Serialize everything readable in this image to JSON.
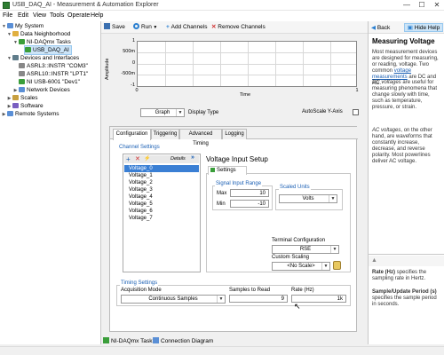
{
  "window": {
    "title": "USB_DAQ_AI - Measurement & Automation Explorer",
    "minimize": "—",
    "maximize": "☐",
    "close": "✕"
  },
  "menu": [
    "File",
    "Edit",
    "View",
    "Tools",
    "Operate",
    "Help"
  ],
  "tree": {
    "items": [
      {
        "label": "My System"
      },
      {
        "label": "Data Neighborhood"
      },
      {
        "label": "NI-DAQmx Tasks"
      },
      {
        "label": "USB_DAQ_AI"
      },
      {
        "label": "Devices and Interfaces"
      },
      {
        "label": "ASRL3::INSTR \"COM3\""
      },
      {
        "label": "ASRL10::INSTR \"LPT1\""
      },
      {
        "label": "NI USB-6001 \"Dev1\""
      },
      {
        "label": "Network Devices"
      },
      {
        "label": "Scales"
      },
      {
        "label": "Software"
      },
      {
        "label": "Remote Systems"
      }
    ]
  },
  "toolbar": {
    "save": "Save",
    "run": "Run",
    "add_channels": "Add Channels",
    "remove_channels": "Remove Channels",
    "hide_help": "Hide Help"
  },
  "graph": {
    "ylabel": "Amplitude",
    "xlabel": "Time",
    "yticks": [
      "1",
      "500m",
      "0",
      "-500m",
      "-1"
    ],
    "xticks": [
      "0",
      "1"
    ],
    "display_type_value": "Graph",
    "display_type_label": "Display Type",
    "autoscale_label": "AutoScale Y-Axis"
  },
  "config": {
    "tabs": [
      "Configuration",
      "Triggering",
      "Advanced Timing",
      "Logging"
    ],
    "channel_settings_label": "Channel Settings",
    "details_label": "Details",
    "channels": [
      "Voltage_0",
      "Voltage_1",
      "Voltage_2",
      "Voltage_3",
      "Voltage_4",
      "Voltage_5",
      "Voltage_6",
      "Voltage_7"
    ],
    "setup_title": "Voltage Input Setup",
    "settings_tab": "Settings",
    "signal_range_label": "Signal Input Range",
    "max_label": "Max",
    "max_value": "10",
    "min_label": "Min",
    "min_value": "-10",
    "scaled_units_label": "Scaled Units",
    "scaled_units_value": "Volts",
    "terminal_config_label": "Terminal Configuration",
    "terminal_config_value": "RSE",
    "custom_scaling_label": "Custom Scaling",
    "custom_scaling_value": "<No Scale>",
    "timing_settings_label": "Timing Settings",
    "acq_mode_label": "Acquisition Mode",
    "acq_mode_value": "Continuous Samples",
    "samples_label": "Samples to Read",
    "samples_value": "9",
    "rate_label": "Rate (Hz)",
    "rate_value": "1k"
  },
  "help": {
    "back": "Back",
    "title": "Measuring Voltage",
    "p1": "Most measurement devices are designed for measuring, or reading, voltage. Two common",
    "p1_link": "voltage measurements",
    "p1_end": "are DC and AC.",
    "p2_em": "DC voltages",
    "p2": "are useful for measuring phenomena that change slowly with time, such as temperature, pressure, or strain.",
    "p3_em": "AC voltages",
    "p3": ", on the other hand, are waveforms that constantly increase, decrease, and reverse polarity. Most powerlines deliver AC voltage.",
    "rate_bold": "Rate (Hz)",
    "rate_text": "specifies the sampling rate in Hertz.",
    "sup_bold": "Sample/Update Period (s)",
    "sup_text": "specifies the sample period in seconds."
  },
  "bottom_tabs": {
    "task": "NI-DAQmx Task",
    "diagram": "Connection Diagram"
  }
}
